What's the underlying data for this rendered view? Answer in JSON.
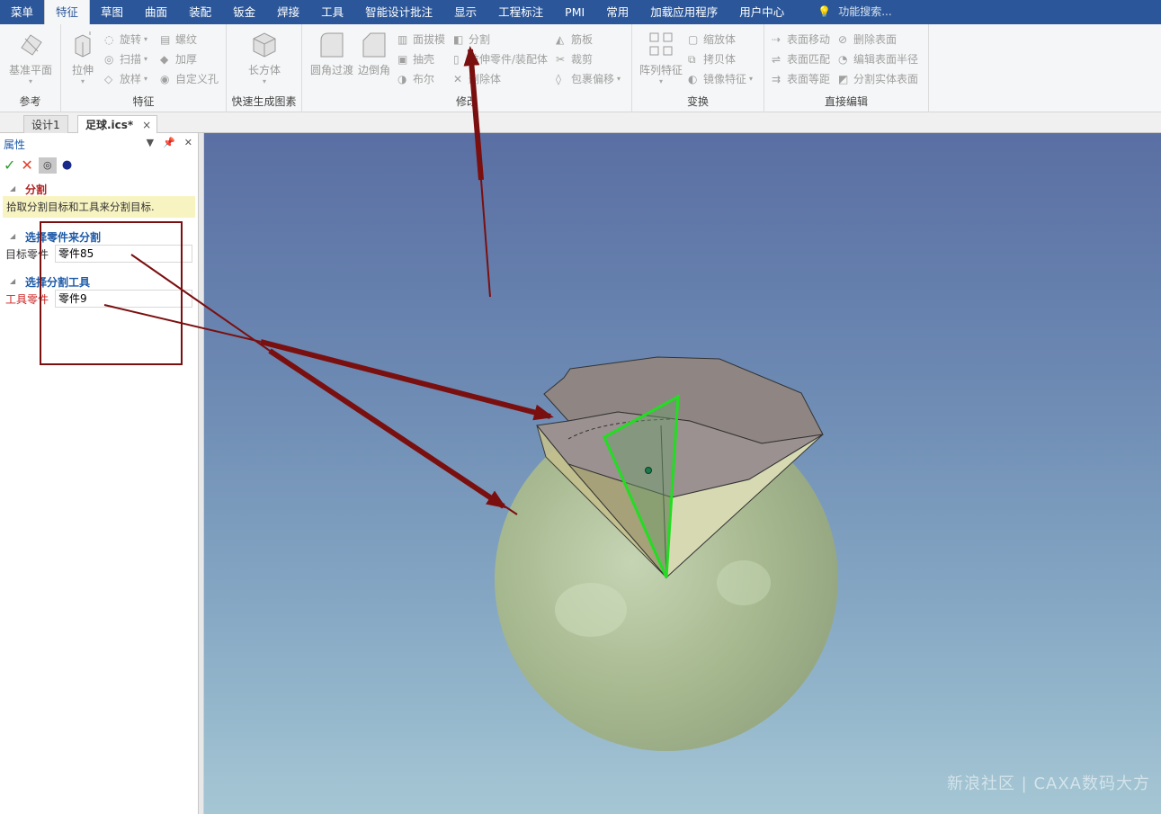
{
  "menubar": {
    "tabs": [
      "菜单",
      "特征",
      "草图",
      "曲面",
      "装配",
      "钣金",
      "焊接",
      "工具",
      "智能设计批注",
      "显示",
      "工程标注",
      "PMI",
      "常用",
      "加载应用程序",
      "用户中心"
    ],
    "active_index": 1,
    "search_placeholder": "功能搜索..."
  },
  "ribbon": {
    "groups": {
      "reference": {
        "label": "参考",
        "base_plane": "基准平面"
      },
      "feature": {
        "label": "特征",
        "extrude": "拉伸",
        "revolve": "旋转",
        "thread": "螺纹",
        "sweep": "扫描",
        "thicken": "加厚",
        "loft": "放样",
        "custom_hole": "自定义孔"
      },
      "quick": {
        "label": "快速生成图素",
        "box": "长方体"
      },
      "modify": {
        "label": "修改",
        "fillet": "圆角过渡",
        "chamfer": "边倒角",
        "draft": "面拔模",
        "shell": "抽壳",
        "boolean": "布尔",
        "split": "分割",
        "extrude_part": "拉伸零件/装配体",
        "remove": "删除体",
        "rib": "筋板",
        "trim": "裁剪",
        "wrap_offset": "包裹偏移"
      },
      "transform": {
        "label": "变换",
        "pattern": "阵列特征",
        "scale": "缩放体",
        "copy": "拷贝体",
        "mirror": "镜像特征"
      },
      "direct_edit": {
        "label": "直接编辑",
        "move_face": "表面移动",
        "delete_face": "删除表面",
        "match_face": "表面匹配",
        "edit_radius": "编辑表面半径",
        "offset_face": "表面等距",
        "split_solid_face": "分割实体表面"
      }
    }
  },
  "doc_tabs": [
    "设计1",
    "足球.ics*"
  ],
  "doc_tab_close": "×",
  "panel": {
    "title": "属性",
    "section_split": "分割",
    "hint": "拾取分割目标和工具来分割目标.",
    "section_target": "选择零件来分割",
    "target_label": "目标零件",
    "target_value": "零件85",
    "section_tool": "选择分割工具",
    "tool_label": "工具零件",
    "tool_value": "零件9"
  },
  "watermark": "新浪社区 | CAXA数码大方",
  "colors": {
    "accent": "#2b579a",
    "highlight_green": "#22dd22",
    "arrow": "#7a0f0f",
    "title_red": "#b22222",
    "section_blue": "#1e5aa8"
  }
}
